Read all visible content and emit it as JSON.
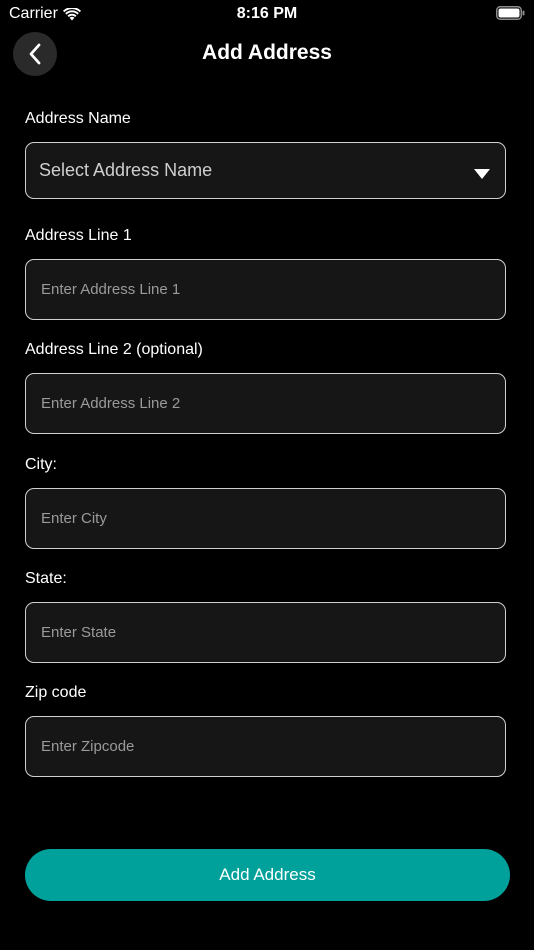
{
  "status_bar": {
    "carrier": "Carrier",
    "time": "8:16 PM",
    "icons": [
      "wifi-icon",
      "battery-icon"
    ]
  },
  "header": {
    "title": "Add Address",
    "back_icon": "chevron-left-icon"
  },
  "form": {
    "address_name": {
      "label": "Address Name",
      "selected": "Select Address Name",
      "icon": "dropdown-triangle-icon"
    },
    "address_line_1": {
      "label": "Address Line 1",
      "placeholder": "Enter Address Line 1",
      "value": ""
    },
    "address_line_2": {
      "label": "Address Line 2 (optional)",
      "placeholder": "Enter Address Line 2",
      "value": ""
    },
    "city": {
      "label": "City:",
      "placeholder": "Enter City",
      "value": ""
    },
    "state": {
      "label": "State:",
      "placeholder": "Enter State",
      "value": ""
    },
    "zipcode": {
      "label": "Zip code",
      "placeholder": "Enter Zipcode",
      "value": ""
    }
  },
  "submit_label": "Add Address",
  "colors": {
    "background": "#000000",
    "field_background": "#161616",
    "field_border": "#d0d0d0",
    "accent": "#00a19b",
    "placeholder": "#9a9a9a"
  }
}
